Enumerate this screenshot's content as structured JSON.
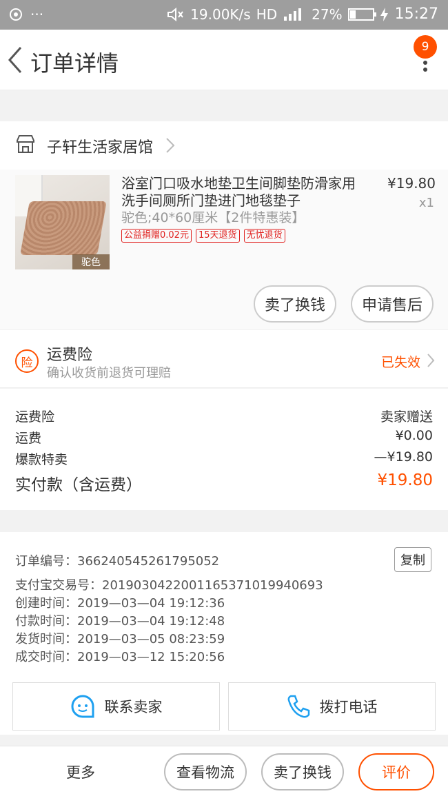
{
  "status_bar": {
    "dots": "···",
    "speed": "19.00K/s",
    "network": "HD",
    "battery": "27%",
    "time": "15:27"
  },
  "nav": {
    "title": "订单详情",
    "badge_count": "9"
  },
  "shop": {
    "name": "子轩生活家居馆"
  },
  "item": {
    "title": "浴室门口吸水地垫卫生间脚垫防滑家用洗手间厕所门垫进门地毯垫子",
    "sku": "驼色;40*60厘米【2件特惠装】",
    "thumb_tag": "驼色",
    "tags": [
      "公益捐赠0.02元",
      "15天退货",
      "无忧退货"
    ],
    "price": "¥19.80",
    "qty": "x1",
    "btn_sell": "卖了换钱",
    "btn_after_sale": "申请售后"
  },
  "insurance": {
    "icon_text": "险",
    "title": "运费险",
    "subtitle": "确认收货前退货可理赔",
    "status": "已失效"
  },
  "fees": {
    "rows": [
      {
        "label": "运费险",
        "value": "卖家赠送"
      },
      {
        "label": "运费",
        "value": "¥0.00"
      },
      {
        "label": "爆款特卖",
        "value": "—¥19.80"
      }
    ],
    "total_label": "实付款（含运费）",
    "total_value": "¥19.80"
  },
  "order_info": {
    "order_no": "订单编号：366240545261795052",
    "alipay_no": "支付宝交易号：2019030422001165371019940693",
    "created": "创建时间：2019—03—04 19:12:36",
    "paid": "付款时间：2019—03—04 19:12:48",
    "shipped": "发货时间：2019—03—05 08:23:59",
    "completed": "成交时间：2019—03—12 15:20:56",
    "copy_label": "复制"
  },
  "contact": {
    "seller": "联系卖家",
    "phone": "拨打电话"
  },
  "bottom": {
    "more": "更多",
    "logistics": "查看物流",
    "sell": "卖了换钱",
    "review": "评价"
  },
  "colors": {
    "accent": "#ff5000",
    "tag_red": "#e0201e",
    "icon_blue": "#1ea0f0",
    "status_bar": "#9e9e9e"
  }
}
